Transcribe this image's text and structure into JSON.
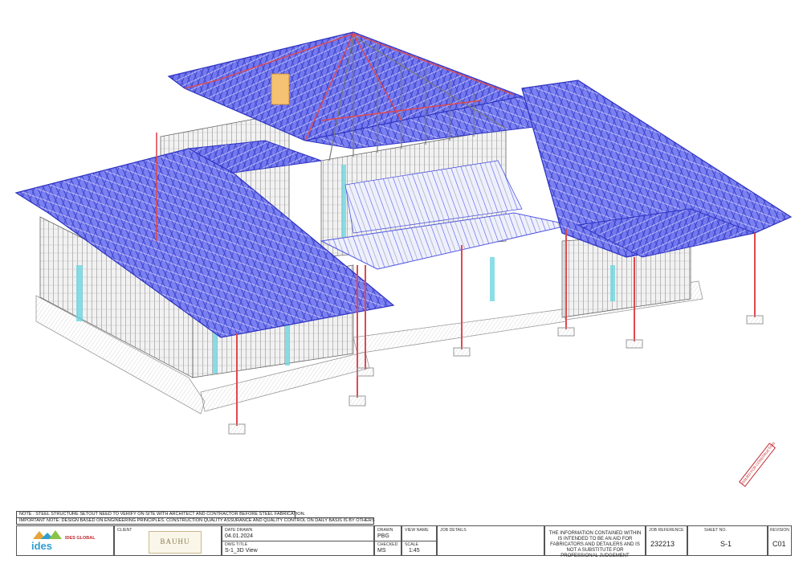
{
  "notes": {
    "note1": "NOTE : STEEL STRUCTURE SETOUT NEED TO VERIFY ON SITE WITH ARCHITECT AND CONTRACTOR BEFORE STEEL FABRICATION.",
    "note2": "IMPORTANT NOTE: DESIGN BASED ON ENGINEERING PRINCIPLES. CONSTRUCTION QUALITY ASSURANCE AND QUALITY CONTROL ON DAILY BASIS IS BY OTHERS"
  },
  "stamp": "ISSUED FOR CONSTRUCTION",
  "title_block": {
    "company_logo_text": "ides",
    "company_name": "IDES GLOBAL",
    "client_label": "CLIENT",
    "client_logo_text": "BAUHU",
    "date_drawn_label": "DATE DRAWN",
    "date_drawn": "04.01.2024",
    "dwg_title_label": "DWG TITLE",
    "dwg_title": "S-1_3D View",
    "drawn_label": "DRAWN",
    "drawn": "PBG",
    "checked_label": "CHECKED",
    "checked": "MS",
    "view_name_label": "VIEW NAME",
    "scale_label": "SCALE",
    "scale": "1:45",
    "job_details_label": "JOB DETAILS",
    "disclaimer": "THE INFORMATION CONTAINED WITHIN IS INTENDED TO BE AN AID FOR FABRICATORS AND DETAILERS AND IS NOT A SUBSTITUTE FOR PROFESSIONAL JUDGEMENT",
    "job_ref_label": "JOB REFERENCE",
    "job_ref": "232213",
    "sheet_no_label": "SHEET NO.",
    "sheet_no": "S-1",
    "revision_label": "REVISION",
    "revision": "C01"
  },
  "colors": {
    "roof_truss": "#4a4fe6",
    "steel_column": "#e0484e",
    "wall_frame": "#8a8a8a",
    "footing": "#d8d8d8",
    "glazing": "#6fd6e0"
  }
}
